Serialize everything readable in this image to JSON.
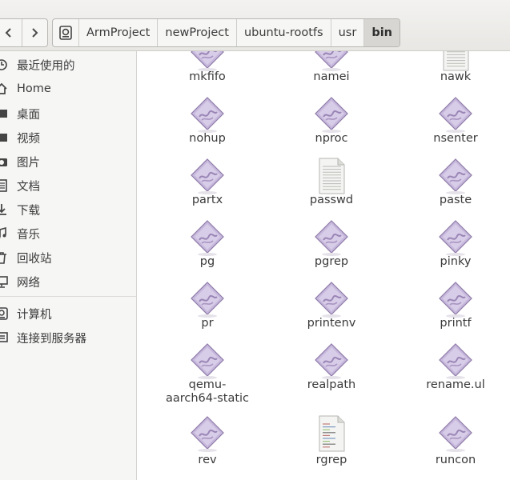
{
  "toolbar": {
    "back_icon": "chevron-left-icon",
    "forward_icon": "chevron-right-icon",
    "breadcrumbs": [
      "ArmProject",
      "newProject",
      "ubuntu-rootfs",
      "usr",
      "bin"
    ],
    "active_crumb": "bin"
  },
  "sidebar": {
    "items": [
      {
        "label": "最近使用的",
        "icon": "clock-icon"
      },
      {
        "label": "Home",
        "icon": "home-icon"
      },
      {
        "label": "桌面",
        "icon": "desktop-icon"
      },
      {
        "label": "视频",
        "icon": "video-icon"
      },
      {
        "label": "图片",
        "icon": "camera-icon"
      },
      {
        "label": "文档",
        "icon": "document-icon"
      },
      {
        "label": "下载",
        "icon": "download-icon"
      },
      {
        "label": "音乐",
        "icon": "music-icon"
      },
      {
        "label": "回收站",
        "icon": "trash-icon"
      },
      {
        "label": "网络",
        "icon": "network-icon"
      },
      {
        "label": "计算机",
        "icon": "computer-icon"
      },
      {
        "label": "连接到服务器",
        "icon": "server-icon"
      }
    ]
  },
  "files": [
    {
      "name": "mkfifo",
      "type": "executable"
    },
    {
      "name": "namei",
      "type": "executable"
    },
    {
      "name": "nawk",
      "type": "text"
    },
    {
      "name": "nohup",
      "type": "executable"
    },
    {
      "name": "nproc",
      "type": "executable"
    },
    {
      "name": "nsenter",
      "type": "executable"
    },
    {
      "name": "partx",
      "type": "executable"
    },
    {
      "name": "passwd",
      "type": "text"
    },
    {
      "name": "paste",
      "type": "executable"
    },
    {
      "name": "pg",
      "type": "executable"
    },
    {
      "name": "pgrep",
      "type": "executable"
    },
    {
      "name": "pinky",
      "type": "executable"
    },
    {
      "name": "pr",
      "type": "executable"
    },
    {
      "name": "printenv",
      "type": "executable"
    },
    {
      "name": "printf",
      "type": "executable"
    },
    {
      "name": "qemu-aarch64-static",
      "type": "executable"
    },
    {
      "name": "realpath",
      "type": "executable"
    },
    {
      "name": "rename.ul",
      "type": "executable"
    },
    {
      "name": "rev",
      "type": "executable"
    },
    {
      "name": "rgrep",
      "type": "script"
    },
    {
      "name": "runcon",
      "type": "executable"
    }
  ],
  "colors": {
    "exec_icon": "#b7a6cf",
    "text_icon": "#e9e9e6",
    "active_crumb_bg": "#d8d6d2"
  }
}
